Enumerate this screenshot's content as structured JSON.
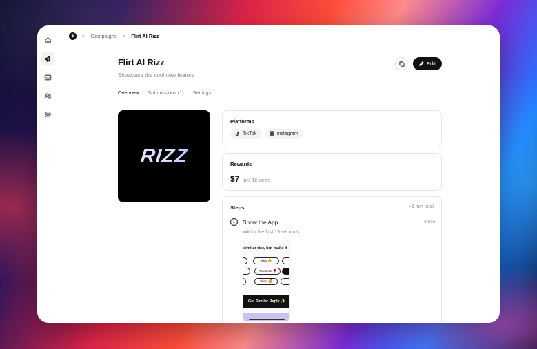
{
  "app": {
    "logo_glyph": "$",
    "accent": "#111111"
  },
  "breadcrumb": {
    "items": [
      "Campaigns",
      "Flirt AI Rizz"
    ],
    "separator": ">"
  },
  "sidebar": {
    "items": [
      {
        "name": "home-icon",
        "active": false
      },
      {
        "name": "megaphone-icon",
        "active": true
      },
      {
        "name": "inbox-icon",
        "active": false
      },
      {
        "name": "users-icon",
        "active": false
      },
      {
        "name": "settings-icon",
        "active": false
      }
    ]
  },
  "header": {
    "title": "Flirt AI Rizz",
    "subtitle": "Showcase the cool new feature",
    "edit_label": "Edit"
  },
  "tabs": [
    {
      "label": "Overview",
      "active": true
    },
    {
      "label": "Submissions (1)",
      "active": false
    },
    {
      "label": "Settings",
      "active": false
    }
  ],
  "hero": {
    "text": "RIZZ"
  },
  "platforms": {
    "title": "Platforms",
    "items": [
      {
        "label": "TikTok",
        "icon": "tiktok-icon"
      },
      {
        "label": "instagram",
        "icon": "instagram-icon"
      }
    ]
  },
  "rewards": {
    "title": "Rewards",
    "amount": "$7",
    "unit": "per 1k views"
  },
  "steps": {
    "title": "Steps",
    "total": "~6 min total",
    "items": [
      {
        "number": "1",
        "name": "Show the App",
        "time": "3 min",
        "description": "Within the first 15 seconds."
      }
    ]
  },
  "phone_preview": {
    "headline": "similar rizz, but make it",
    "pills": [
      "Witty 😏",
      "Romantic 🌹",
      "Short 🍊",
      "",
      "",
      "",
      "",
      ""
    ],
    "cta": "Get Similar Reply ✨"
  }
}
